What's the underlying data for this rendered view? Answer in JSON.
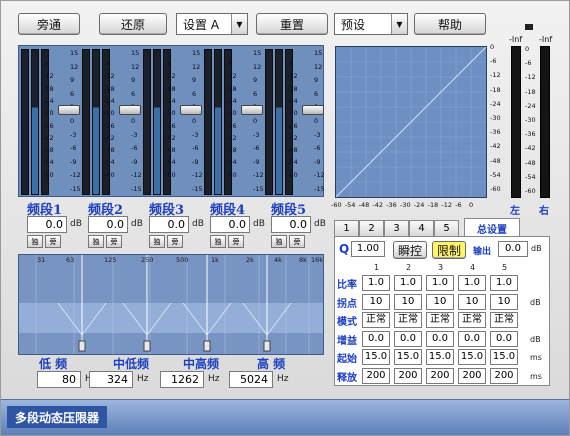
{
  "toolbar": {
    "bypass_label": "旁通",
    "restore_label": "还原",
    "settings_value": "设置 A",
    "reset_label": "重置",
    "preset_value": "预设",
    "help_label": "帮助"
  },
  "eq_scale": [
    "-6",
    "-12",
    "-18",
    "-24",
    "-30",
    "-36",
    "-42",
    "-48",
    "-54",
    "-60"
  ],
  "eq_scale_right": [
    "15",
    "12",
    "9",
    "6",
    "3",
    "0",
    "-3",
    "-6",
    "-9",
    "-12",
    "-15"
  ],
  "bands": [
    {
      "label": "频段1",
      "value": "0.0",
      "unit": "dB",
      "btn1": "独",
      "btn2": "旁",
      "level": 0.6
    },
    {
      "label": "频段2",
      "value": "0.0",
      "unit": "dB",
      "btn1": "独",
      "btn2": "旁",
      "level": 0.6
    },
    {
      "label": "频段3",
      "value": "0.0",
      "unit": "dB",
      "btn1": "独",
      "btn2": "旁",
      "level": 0.6
    },
    {
      "label": "频段4",
      "value": "0.0",
      "unit": "dB",
      "btn1": "独",
      "btn2": "旁",
      "level": 0.6
    },
    {
      "label": "频段5",
      "value": "0.0",
      "unit": "dB",
      "btn1": "独",
      "btn2": "旁",
      "level": 0.6
    }
  ],
  "graph": {
    "x_ticks": [
      "-60",
      "-54",
      "-48",
      "-42",
      "-36",
      "-30",
      "-24",
      "-18",
      "-12",
      "-6",
      "0"
    ],
    "y_ticks": [
      "0",
      "-6",
      "-12",
      "-18",
      "-24",
      "-30",
      "-36",
      "-42",
      "-48",
      "-54",
      "-60"
    ]
  },
  "meters": {
    "left_peak": "-Inf",
    "right_peak": "-Inf",
    "scale": [
      "0",
      "-6",
      "-12",
      "-18",
      "-24",
      "-30",
      "-36",
      "-42",
      "-48",
      "-54",
      "-60"
    ],
    "left_label": "左",
    "right_label": "右"
  },
  "tabs": [
    "1",
    "2",
    "3",
    "4",
    "5",
    "总设置"
  ],
  "settings": {
    "q_label": "Q",
    "q_value": "1.00",
    "transient_label": "瞬控",
    "limit_label": "限制",
    "output_label": "输出",
    "output_value": "0.0",
    "output_unit": "dB",
    "col_headers": [
      "1",
      "2",
      "3",
      "4",
      "5"
    ],
    "rows": [
      {
        "label": "比率",
        "values": [
          "1.0",
          "1.0",
          "1.0",
          "1.0",
          "1.0"
        ],
        "unit": ""
      },
      {
        "label": "拐点",
        "values": [
          "10",
          "10",
          "10",
          "10",
          "10"
        ],
        "unit": "dB"
      },
      {
        "label": "模式",
        "values": [
          "正常",
          "正常",
          "正常",
          "正常",
          "正常"
        ],
        "unit": ""
      },
      {
        "label": "增益",
        "values": [
          "0.0",
          "0.0",
          "0.0",
          "0.0",
          "0.0"
        ],
        "unit": "dB"
      },
      {
        "label": "起始",
        "values": [
          "15.0",
          "15.0",
          "15.0",
          "15.0",
          "15.0"
        ],
        "unit": "ms"
      },
      {
        "label": "释放",
        "values": [
          "200",
          "200",
          "200",
          "200",
          "200"
        ],
        "unit": "ms"
      }
    ]
  },
  "crossover": {
    "freq_ticks": [
      "31",
      "63",
      "125",
      "250",
      "500",
      "1k",
      "2k",
      "4k",
      "8k",
      "16k"
    ],
    "points": [
      {
        "label": "低 频",
        "value": "80",
        "unit": "Hz"
      },
      {
        "label": "中低频",
        "value": "324",
        "unit": "Hz"
      },
      {
        "label": "中高频",
        "value": "1262",
        "unit": "Hz"
      },
      {
        "label": "高 频",
        "value": "5024",
        "unit": "Hz"
      }
    ]
  },
  "status": {
    "title": "多段动态压限器"
  },
  "colors": {
    "accent": "#1b3fbf",
    "panel": "#6f8fbd",
    "graph": "#6d8fc2",
    "status": "#2f55a4"
  }
}
